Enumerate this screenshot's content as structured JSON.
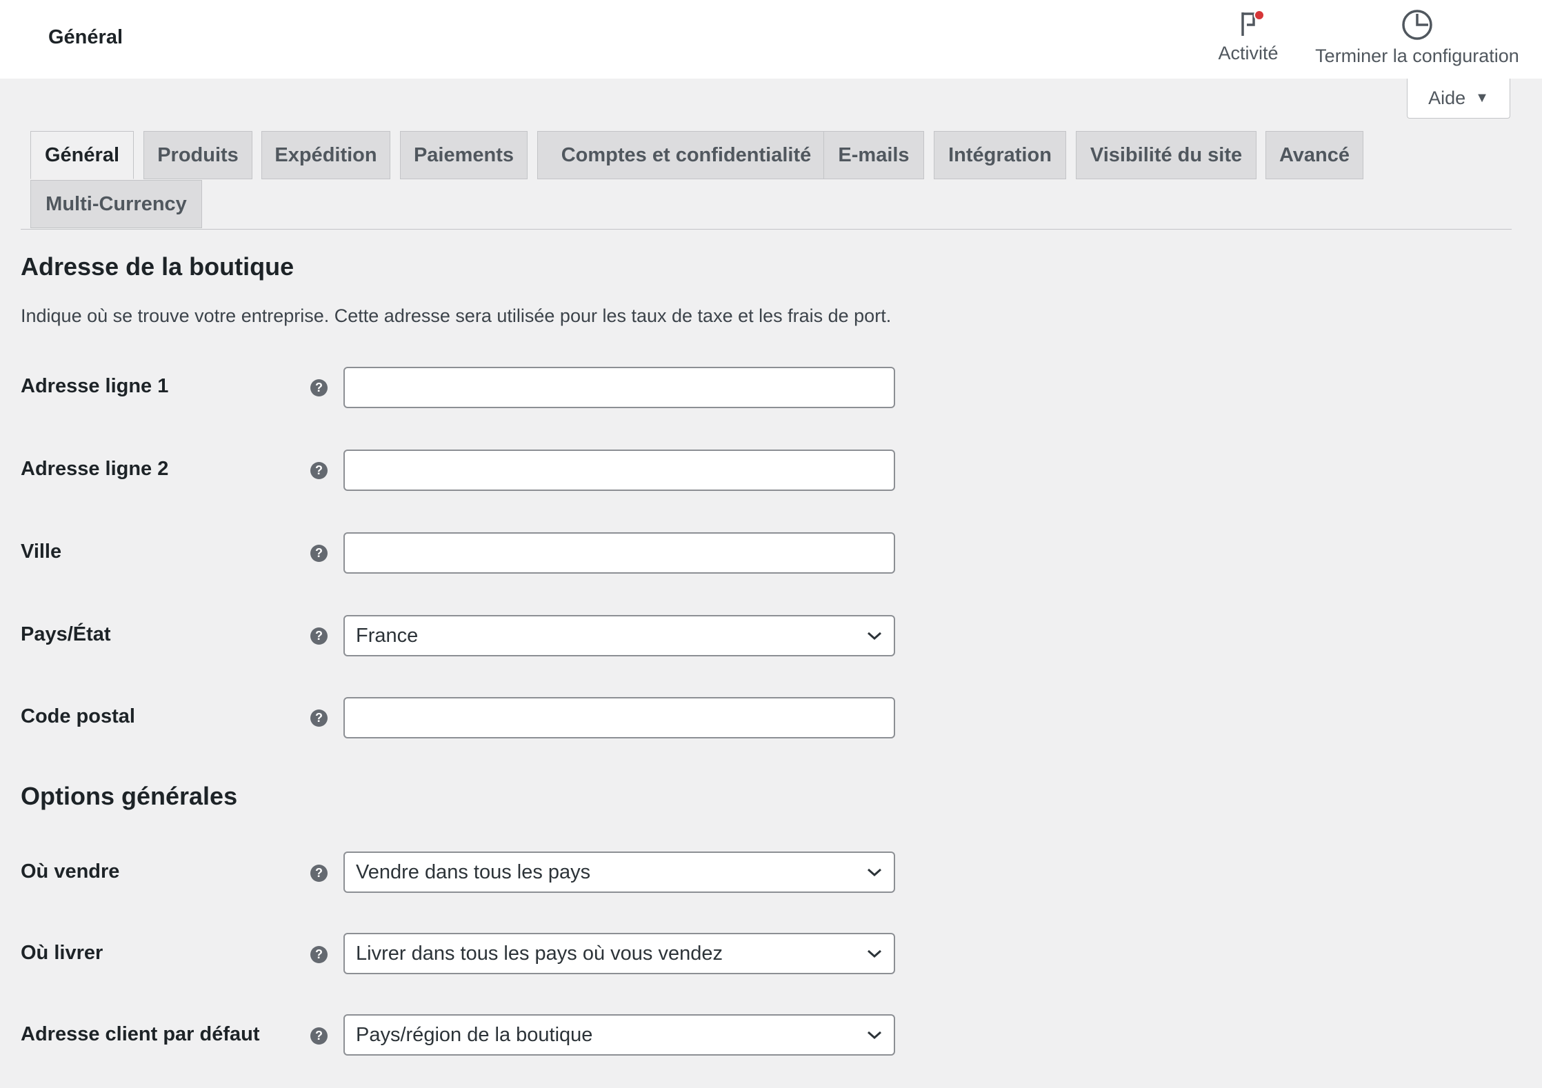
{
  "header": {
    "title": "Général",
    "actions": [
      {
        "label": "Activité",
        "icon": "flag-icon"
      },
      {
        "label": "Terminer la configuration",
        "icon": "progress-circle-icon"
      }
    ],
    "help_label": "Aide"
  },
  "tabs": [
    {
      "label": "Général",
      "active": true
    },
    {
      "label": "Produits"
    },
    {
      "label": "Expédition"
    },
    {
      "label": "Paiements"
    },
    {
      "label": "Comptes et confidentialité"
    },
    {
      "label": "E-mails"
    },
    {
      "label": "Intégration"
    },
    {
      "label": "Visibilité du site"
    },
    {
      "label": "Avancé"
    },
    {
      "label": "Multi-Currency"
    }
  ],
  "store_address": {
    "title": "Adresse de la boutique",
    "description": "Indique où se trouve votre entreprise. Cette adresse sera utilisée pour les taux de taxe et les frais de port.",
    "fields": [
      {
        "label": "Adresse ligne 1",
        "value": ""
      },
      {
        "label": "Adresse ligne 2",
        "value": ""
      },
      {
        "label": "Ville",
        "value": ""
      },
      {
        "label": "Pays/État",
        "value": "France"
      },
      {
        "label": "Code postal",
        "value": ""
      }
    ]
  },
  "general_options": {
    "title": "Options générales",
    "fields": [
      {
        "label": "Où vendre",
        "value": "Vendre dans tous les pays"
      },
      {
        "label": "Où livrer",
        "value": "Livrer dans tous les pays où vous vendez"
      },
      {
        "label": "Adresse client par défaut",
        "value": "Pays/région de la boutique"
      }
    ]
  },
  "colors": {
    "background": "#f0f0f1",
    "header_bg": "#ffffff",
    "notification_dot": "#d63638",
    "tab_inactive": "#dcdcde"
  }
}
